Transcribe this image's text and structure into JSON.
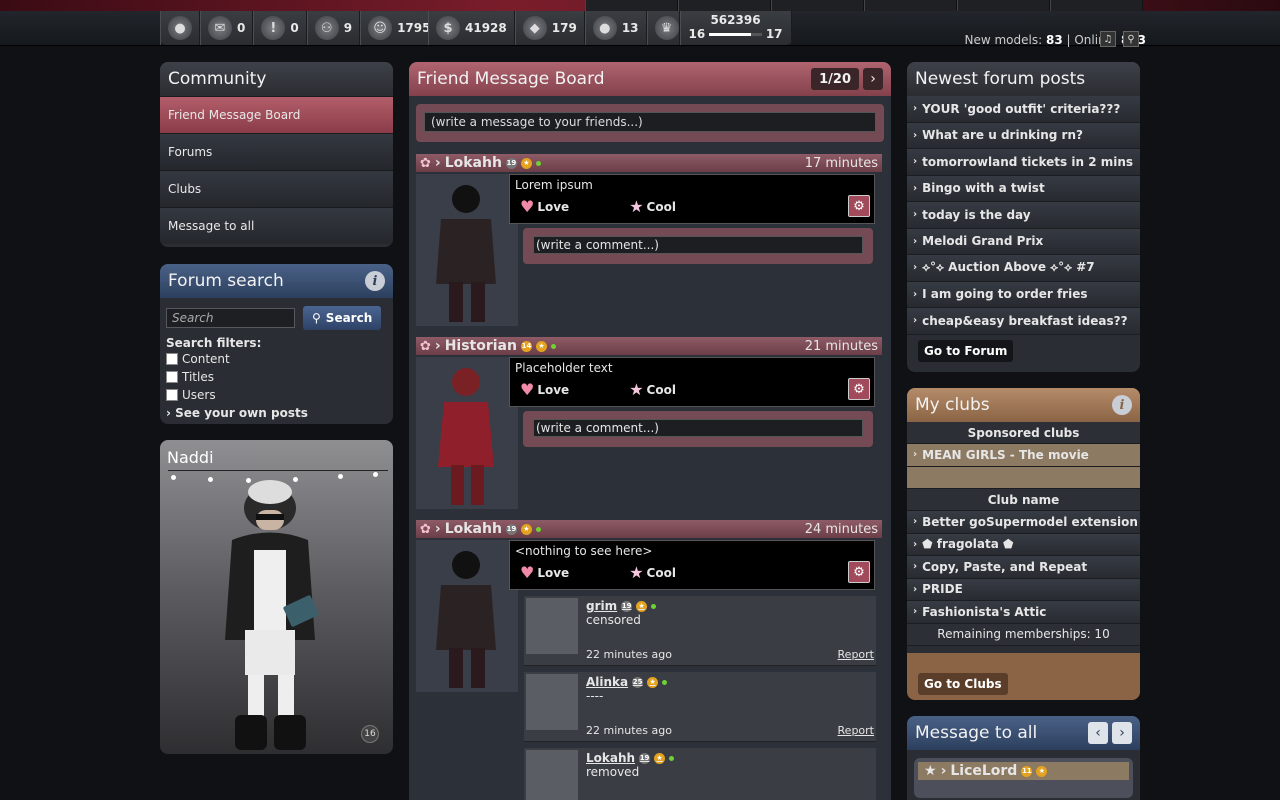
{
  "topbar": {
    "stats": [
      {
        "icon": "profile-icon",
        "value": ""
      },
      {
        "icon": "mail-icon",
        "value": "0"
      },
      {
        "icon": "alert-icon",
        "value": "0"
      },
      {
        "icon": "friends-icon",
        "value": "9"
      },
      {
        "icon": "smiley-icon",
        "value": "1795"
      }
    ],
    "currency": [
      {
        "icon": "coin-icon",
        "value": "41928"
      },
      {
        "icon": "diamond-icon",
        "value": "179"
      },
      {
        "icon": "pearl-icon",
        "value": "13"
      }
    ],
    "level": {
      "icon": "crown-icon",
      "points": "562396",
      "current": "16",
      "next": "17",
      "progress": 0.8
    },
    "new_models_label": "New models:",
    "new_models": "83",
    "online_label": "Online:",
    "online": "823"
  },
  "community": {
    "title": "Community",
    "items": [
      "Friend Message Board",
      "Forums",
      "Clubs",
      "Message to all"
    ]
  },
  "forum_search": {
    "title": "Forum search",
    "placeholder": "Search",
    "button": "Search",
    "filters_label": "Search filters:",
    "filters": [
      "Content",
      "Titles",
      "Users"
    ],
    "own_posts": "See your own posts"
  },
  "profile": {
    "name": "Naddi",
    "level": "16"
  },
  "board": {
    "title": "Friend Message Board",
    "page": "1/20",
    "write_placeholder": "(write a message to your friends...)",
    "love_label": "Love",
    "cool_label": "Cool",
    "comment_placeholder": "(write a comment...)",
    "posts": [
      {
        "author": "Lokahh",
        "level": "19",
        "time": "17 minutes",
        "text": "Lorem ipsum"
      },
      {
        "author": "Historian",
        "level": "14",
        "time": "21 minutes",
        "text": "Placeholder text"
      },
      {
        "author": "Lokahh",
        "level": "19",
        "time": "24 minutes",
        "text": "<nothing to see here>"
      }
    ],
    "comments": [
      {
        "author": "grim",
        "level": "19",
        "text": "censored",
        "ago": "22 minutes ago",
        "report": "Report"
      },
      {
        "author": "Alinka",
        "level": "25",
        "text": "----",
        "ago": "22 minutes ago",
        "report": "Report"
      },
      {
        "author": "Lokahh",
        "level": "19",
        "text": "removed",
        "ago": "",
        "report": ""
      }
    ]
  },
  "forum_posts": {
    "title": "Newest forum posts",
    "items": [
      "YOUR 'good outfit' criteria???",
      "What are u drinking rn?",
      "tomorrowland tickets in 2 mins",
      "Bingo with a twist",
      "today is the day",
      "Melodi Grand Prix",
      "⟡°⟡ Auction Above ⟡°⟡ #7",
      "I am going to order fries",
      "cheap&easy breakfast ideas??"
    ],
    "button": "Go to Forum"
  },
  "my_clubs": {
    "title": "My clubs",
    "sponsored_label": "Sponsored clubs",
    "sponsored": [
      "MEAN GIRLS - The movie"
    ],
    "clubname_label": "Club name",
    "clubs": [
      "Better goSupermodel extension",
      "⬟ fragolata ⬟",
      "Copy, Paste, and Repeat",
      "PRIDE",
      "Fashionista's Attic"
    ],
    "remaining": "Remaining memberships: 10",
    "button": "Go to Clubs"
  },
  "message_all": {
    "title": "Message to all",
    "author": "LiceLord",
    "level": "11"
  },
  "colors": {
    "accent_rose": "#8b3c48",
    "accent_blue": "#2d3f5e",
    "accent_tan": "#8a6445"
  }
}
